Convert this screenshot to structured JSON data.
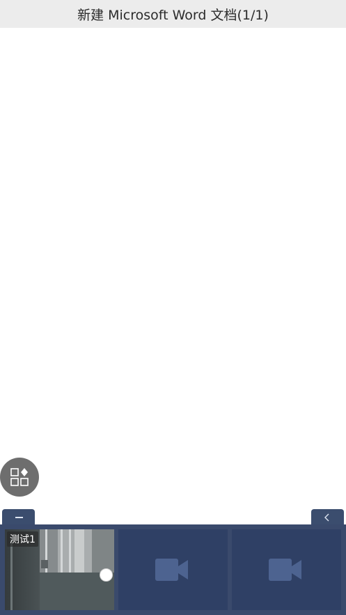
{
  "header": {
    "title": "新建 Microsoft Word 文档(1/1)"
  },
  "fab": {
    "icon": "apps-grid-icon"
  },
  "panel": {
    "collapse_icon": "minus-icon",
    "back_icon": "chevron-left-icon",
    "tiles": [
      {
        "label": "测试1",
        "state": "live"
      },
      {
        "label": "",
        "state": "empty",
        "icon": "video-camera-icon"
      },
      {
        "label": "",
        "state": "empty",
        "icon": "video-camera-icon"
      }
    ]
  },
  "colors": {
    "title_bar_bg": "#ececec",
    "panel_bg": "#3a4a6c",
    "tile_bg": "#2f4065",
    "camera_icon": "#4d6390",
    "fab_bg": "#6e6e6e"
  }
}
